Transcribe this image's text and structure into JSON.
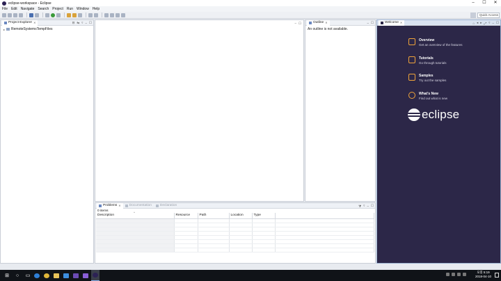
{
  "window": {
    "title": "eclipse-workspace - Eclipse",
    "controls": [
      "–",
      "☐",
      "✕"
    ]
  },
  "menu": [
    "File",
    "Edit",
    "Navigate",
    "Search",
    "Project",
    "Run",
    "Window",
    "Help"
  ],
  "toolbar": {
    "quick_access_placeholder": "Quick Access"
  },
  "explorer": {
    "tab_label": "Project Explorer",
    "tree": [
      {
        "label": "RemoteSystemsTempFiles"
      }
    ]
  },
  "outline": {
    "tab_label": "Outline",
    "message": "An outline is not available."
  },
  "welcome": {
    "tab_label": "Welcome",
    "items": [
      {
        "title": "Overview",
        "desc": "Get an overview of the features",
        "icon": "book-icon"
      },
      {
        "title": "Tutorials",
        "desc": "Go through tutorials",
        "icon": "graduation-cap-icon"
      },
      {
        "title": "Samples",
        "desc": "Try out the samples",
        "icon": "magic-wand-icon"
      },
      {
        "title": "What's New",
        "desc": "Find out what is new",
        "icon": "compass-icon"
      }
    ],
    "logo_text": "eclipse"
  },
  "problems": {
    "tabs": [
      {
        "label": "Problems",
        "active": true
      },
      {
        "label": "Documentation",
        "active": false
      },
      {
        "label": "Declaration",
        "active": false
      }
    ],
    "count": "0 items",
    "columns": [
      "Description",
      "Resource",
      "Path",
      "Location",
      "Type"
    ]
  },
  "taskbar": {
    "apps": [
      "windows-icon",
      "search-icon",
      "task-view-icon",
      "edge-icon",
      "chrome-icon",
      "file-explorer-icon",
      "store-icon",
      "vs-icon",
      "visual-studio-icon",
      "eclipse-icon"
    ],
    "time": "오후 5:19",
    "date": "2018-04-10"
  }
}
